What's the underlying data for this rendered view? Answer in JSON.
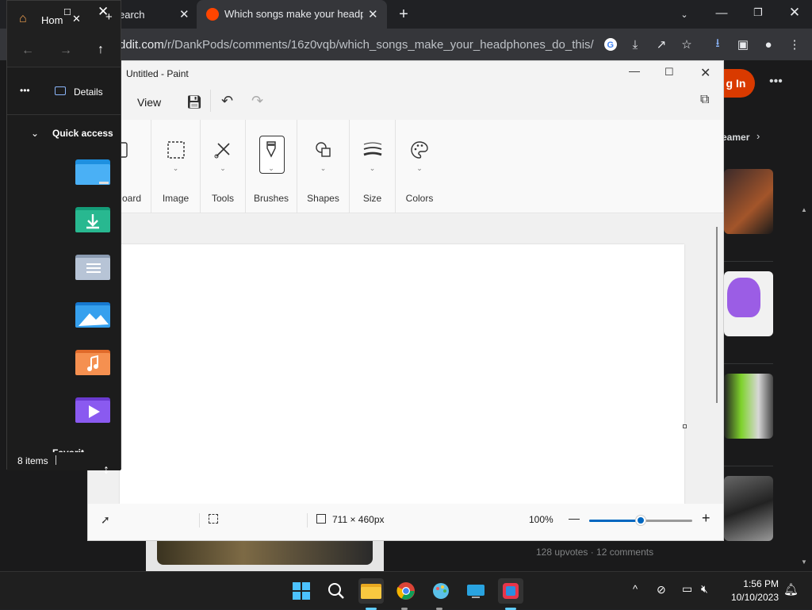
{
  "chrome": {
    "tabs": [
      {
        "title": "earch"
      },
      {
        "title": "Which songs make your headpho"
      }
    ],
    "url_host": "ddit.com",
    "url_path": "/r/DankPods/comments/16z0vqb/which_songs_make_your_headphones_do_this/"
  },
  "reddit": {
    "login_label": "g In",
    "streamers_label": "eamer",
    "post_meta": "128 upvotes · 12 comments"
  },
  "paint": {
    "title": "Untitled - Paint",
    "menu_view": "View",
    "ribbon": {
      "clipboard": "oard",
      "image": "Image",
      "tools": "Tools",
      "brushes": "Brushes",
      "shapes": "Shapes",
      "size": "Size",
      "colors": "Colors"
    },
    "status": {
      "canvas_size": "711 × 460px",
      "zoom": "100%",
      "zoom_level": 0.5
    }
  },
  "explorer": {
    "tab_title": "Hom",
    "more_label": "•••",
    "details_label": "Details",
    "quick_access": "Quick access",
    "items_count": "8 items",
    "next_section": "Favorit"
  },
  "taskbar": {
    "time": "1:56 PM",
    "date": "10/10/2023"
  }
}
